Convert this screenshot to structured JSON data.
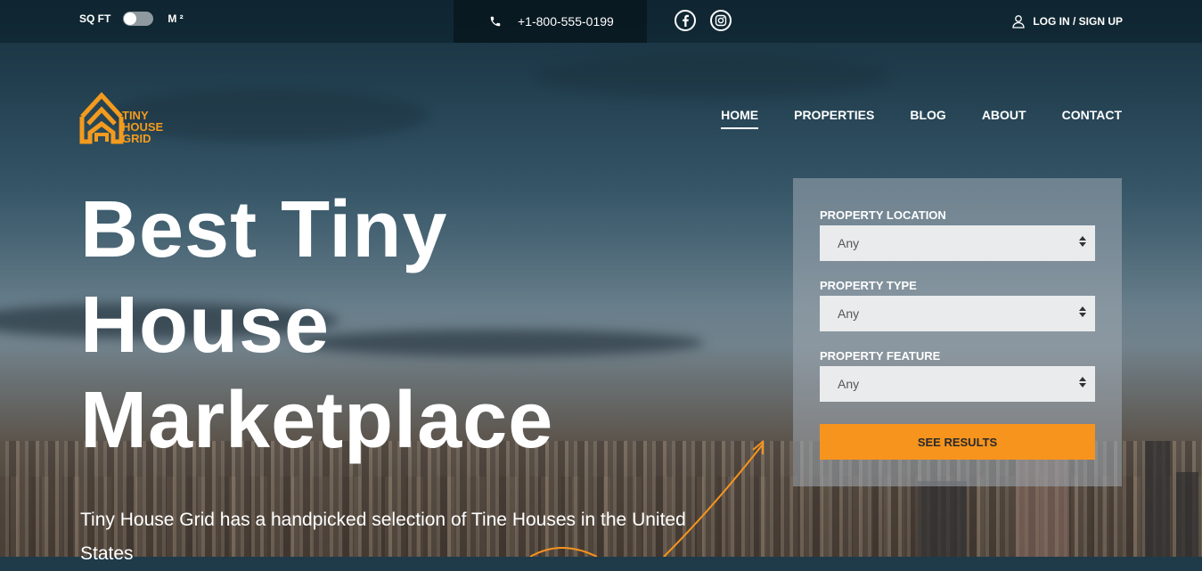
{
  "topbar": {
    "unit_left": "SQ FT",
    "unit_right": "M ²",
    "phone": "+1-800-555-0199",
    "login": "LOG IN / SIGN UP"
  },
  "social": {
    "icons": [
      "facebook-icon",
      "instagram-icon"
    ]
  },
  "logo": {
    "line1": "TINY",
    "line2": "HOUSE",
    "line3": "GRID"
  },
  "nav": {
    "items": [
      {
        "label": "HOME",
        "active": true
      },
      {
        "label": "PROPERTIES"
      },
      {
        "label": "BLOG"
      },
      {
        "label": "ABOUT"
      },
      {
        "label": "CONTACT"
      }
    ]
  },
  "hero": {
    "headline": [
      "Best Tiny",
      "House",
      "Marketplace"
    ],
    "subtext": "Tiny House Grid has a handpicked selection of Tine Houses in the United States"
  },
  "search": {
    "fields": [
      {
        "label": "PROPERTY LOCATION",
        "value": "Any"
      },
      {
        "label": "PROPERTY TYPE",
        "value": "Any"
      },
      {
        "label": "PROPERTY FEATURE",
        "value": "Any"
      }
    ],
    "submit": "SEE RESULTS"
  },
  "colors": {
    "accent": "#f7941d",
    "logo": "#f39b1e"
  }
}
